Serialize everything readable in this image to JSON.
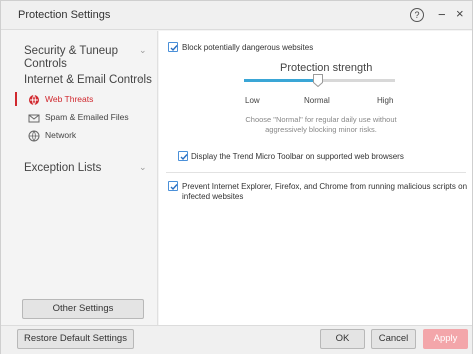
{
  "window": {
    "title": "Protection Settings",
    "help_icon": "?",
    "minimize_icon": "−",
    "close_icon": "×"
  },
  "sidebar": {
    "categories": [
      {
        "label": "Security & Tuneup\nControls",
        "chevron": "⌄",
        "expanded": false
      },
      {
        "label": "Internet & Email Controls",
        "chevron": "^",
        "expanded": true
      },
      {
        "label": "Exception Lists",
        "chevron": "⌄",
        "expanded": false
      }
    ],
    "subitems": [
      {
        "label": "Web Threats",
        "icon": "globe-shield-icon",
        "active": true
      },
      {
        "label": "Spam & Emailed Files",
        "icon": "envelope-icon",
        "active": false
      },
      {
        "label": "Network",
        "icon": "network-icon",
        "active": false
      }
    ],
    "other_settings_label": "Other Settings"
  },
  "main": {
    "block_websites": {
      "label": "Block potentially dangerous websites",
      "checked": true
    },
    "strength": {
      "title": "Protection strength",
      "levels": [
        "Low",
        "Normal",
        "High"
      ],
      "selected": "Normal",
      "description": "Choose \"Normal\" for regular daily use without aggressively blocking minor risks."
    },
    "toolbar_option": {
      "label": "Display the Trend Micro Toolbar on supported web browsers",
      "checked": true
    },
    "scripts_option": {
      "label": "Prevent Internet Explorer, Firefox, and Chrome from running malicious scripts on infected websites",
      "checked": true
    }
  },
  "footer": {
    "restore_label": "Restore Default Settings",
    "ok_label": "OK",
    "cancel_label": "Cancel",
    "apply_label": "Apply"
  },
  "colors": {
    "accent_red": "#d0282e",
    "slider_blue": "#3aa6d6",
    "checkbox_blue": "#4a90d9",
    "apply_disabled": "#f3a6aa"
  }
}
